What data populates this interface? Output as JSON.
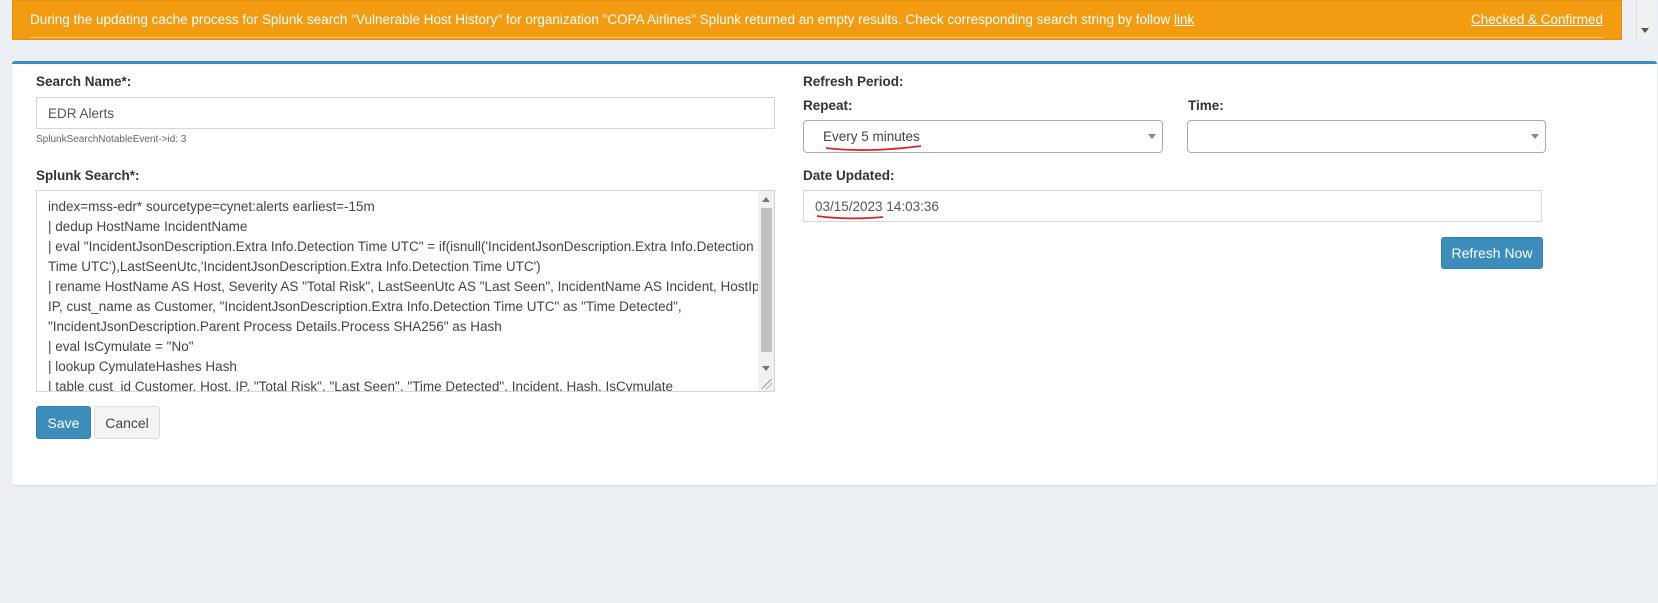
{
  "alert": {
    "message": "During the updating cache process for Splunk search \"Vulnerable Host History\" for organization \"COPA Airlines\" Splunk returned an empty results. Check corresponding search string by follow ",
    "link_label": "link",
    "ack_label": "Checked & Confirmed"
  },
  "form": {
    "search_name_label": "Search Name*:",
    "search_name_value": "EDR Alerts",
    "hint": "SplunkSearchNotableEvent->id: 3",
    "splunk_search_label": "Splunk Search*:",
    "splunk_search_value": "index=mss-edr* sourcetype=cynet:alerts earliest=-15m\n| dedup HostName IncidentName\n| eval \"IncidentJsonDescription.Extra Info.Detection Time UTC\" = if(isnull('IncidentJsonDescription.Extra Info.Detection Time UTC'),LastSeenUtc,'IncidentJsonDescription.Extra Info.Detection Time UTC')\n| rename HostName AS Host, Severity AS \"Total Risk\", LastSeenUtc AS \"Last Seen\", IncidentName AS Incident, HostIp as IP, cust_name as Customer, \"IncidentJsonDescription.Extra Info.Detection Time UTC\" as \"Time Detected\", \"IncidentJsonDescription.Parent Process Details.Process SHA256\" as Hash\n| eval IsCymulate = \"No\"\n| lookup CymulateHashes Hash\n| table cust_id Customer, Host, IP, \"Total Risk\", \"Last Seen\", \"Time Detected\", Incident, Hash, IsCymulate",
    "save_label": "Save",
    "cancel_label": "Cancel"
  },
  "refresh": {
    "period_label": "Refresh Period:",
    "repeat_label": "Repeat:",
    "repeat_value": "Every 5 minutes",
    "time_label": "Time:",
    "time_value": "",
    "date_updated_label": "Date Updated:",
    "date_updated_value": "03/15/2023 14:03:36",
    "refresh_now_label": "Refresh Now"
  },
  "colors": {
    "alert_bg": "#f39c12",
    "primary": "#3c8dbc",
    "annotation": "#d9262c"
  }
}
